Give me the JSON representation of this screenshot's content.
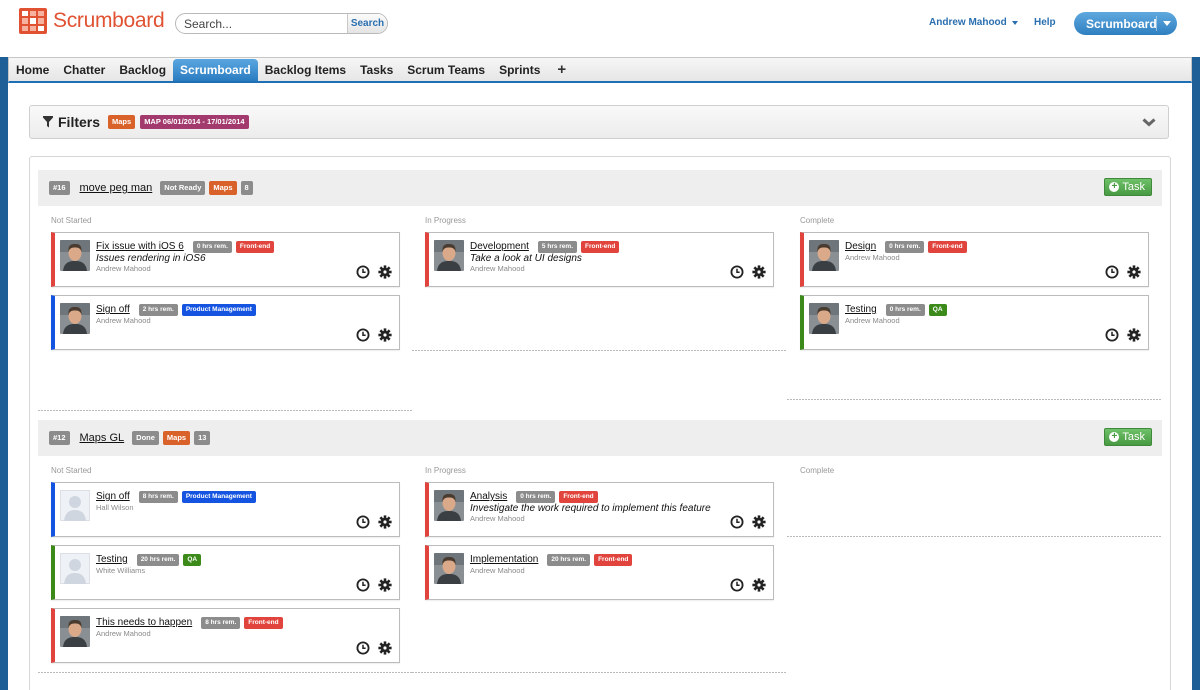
{
  "app": {
    "name": "Scrumboard"
  },
  "search": {
    "placeholder": "Search...",
    "value": "",
    "button_label": "Search"
  },
  "header": {
    "user_name": "Andrew Mahood",
    "help_label": "Help",
    "app_switch_label": "Scrumboard"
  },
  "nav": {
    "tabs": [
      {
        "label": "Home",
        "active": false
      },
      {
        "label": "Chatter",
        "active": false
      },
      {
        "label": "Backlog",
        "active": false
      },
      {
        "label": "Scrumboard",
        "active": true
      },
      {
        "label": "Backlog Items",
        "active": false
      },
      {
        "label": "Tasks",
        "active": false
      },
      {
        "label": "Scrum Teams",
        "active": false
      },
      {
        "label": "Sprints",
        "active": false
      }
    ],
    "add_tab_label": "+"
  },
  "filters": {
    "title": "Filters",
    "tags": [
      {
        "text": "Maps",
        "color": "#d9622b"
      },
      {
        "text": "MAP 06/01/2014 - 17/01/2014",
        "color": "#a23a6e"
      }
    ]
  },
  "columns": [
    "Not Started",
    "In Progress",
    "Complete"
  ],
  "add_task_label": "Task",
  "colors": {
    "front_end": "#e0443c",
    "product_management": "#1554e0",
    "qa": "#3b8a1a",
    "hours": "#8c8c8c",
    "maps": "#d9622b",
    "status": "#8c8c8c",
    "add_button": "#479a42",
    "nav_active": "#2a7cc1"
  },
  "stories": [
    {
      "id": "#16",
      "title": "move peg man",
      "status": "Not Ready",
      "tag": "Maps",
      "points": "8",
      "lanes": [
        [
          {
            "title": "Fix issue with iOS 6",
            "hours": "0 hrs rem.",
            "tag": "Front-end",
            "tag_color": "#e0443c",
            "description": "Issues rendering in iOS6",
            "owner": "Andrew Mahood",
            "avatar": "photo"
          },
          {
            "title": "Sign off",
            "hours": "2 hrs rem.",
            "tag": "Product Management",
            "tag_color": "#1554e0",
            "description": "",
            "owner": "Andrew Mahood",
            "avatar": "photo"
          }
        ],
        [
          {
            "title": "Development",
            "hours": "5 hrs rem.",
            "tag": "Front-end",
            "tag_color": "#e0443c",
            "description": "Take a look at UI designs",
            "owner": "Andrew Mahood",
            "avatar": "photo"
          }
        ],
        [
          {
            "title": "Design",
            "hours": "0 hrs rem.",
            "tag": "Front-end",
            "tag_color": "#e0443c",
            "description": "",
            "owner": "Andrew Mahood",
            "avatar": "photo"
          },
          {
            "title": "Testing",
            "hours": "0 hrs rem.",
            "tag": "QA",
            "tag_color": "#3b8a1a",
            "description": "",
            "owner": "Andrew Mahood",
            "avatar": "photo"
          }
        ]
      ]
    },
    {
      "id": "#12",
      "title": "Maps GL",
      "status": "Done",
      "tag": "Maps",
      "points": "13",
      "lanes": [
        [
          {
            "title": "Sign off",
            "hours": "8 hrs rem.",
            "tag": "Product Management",
            "tag_color": "#1554e0",
            "description": "",
            "owner": "Hall Wilson",
            "avatar": "placeholder"
          },
          {
            "title": "Testing",
            "hours": "20 hrs rem.",
            "tag": "QA",
            "tag_color": "#3b8a1a",
            "description": "",
            "owner": "White Williams",
            "avatar": "placeholder"
          },
          {
            "title": "This needs to happen",
            "hours": "8 hrs rem.",
            "tag": "Front-end",
            "tag_color": "#e0443c",
            "description": "",
            "owner": "Andrew Mahood",
            "avatar": "photo"
          }
        ],
        [
          {
            "title": "Analysis",
            "hours": "0 hrs rem.",
            "tag": "Front-end",
            "tag_color": "#e0443c",
            "description": "Investigate the work required to implement this feature",
            "owner": "Andrew Mahood",
            "avatar": "photo"
          },
          {
            "title": "Implementation",
            "hours": "20 hrs rem.",
            "tag": "Front-end",
            "tag_color": "#e0443c",
            "description": "",
            "owner": "Andrew Mahood",
            "avatar": "photo"
          }
        ],
        []
      ]
    }
  ]
}
